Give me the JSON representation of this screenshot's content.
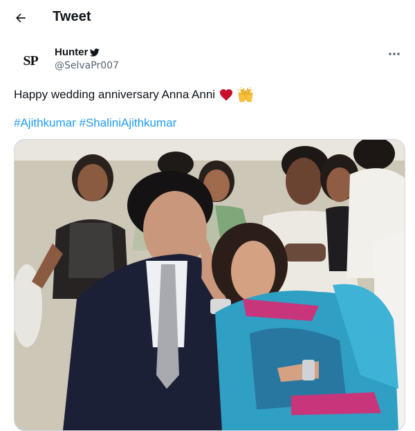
{
  "header": {
    "title": "Tweet",
    "back_icon": "arrow-left-icon"
  },
  "author": {
    "avatar_text": "SP",
    "display_name": "Hunter",
    "handle": "@SelvaPr007",
    "badge_icon": "bird-icon"
  },
  "tweet": {
    "text": "Happy wedding anniversary Anna Anni",
    "emoji_1": "heart-icon",
    "emoji_2": "raised-hands-icon",
    "hashtags": [
      "#Ajithkumar",
      "#ShaliniAjithkumar"
    ]
  },
  "media": {
    "type": "photo"
  },
  "colors": {
    "link": "#1d9bf0",
    "secondary_text": "#536471",
    "border": "#cfd9de",
    "heart": "#e0245e"
  }
}
